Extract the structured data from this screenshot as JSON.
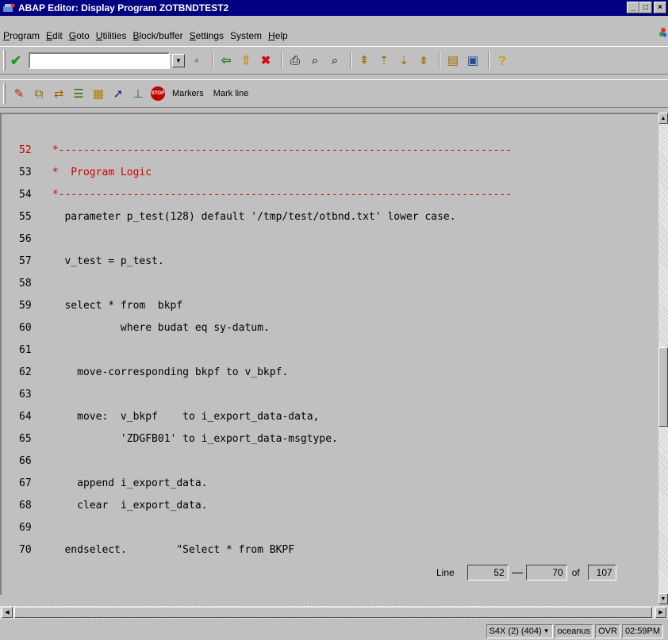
{
  "window": {
    "title": "ABAP Editor: Display Program ZOTBNDTEST2",
    "minimize": "_",
    "maximize": "□",
    "close": "×"
  },
  "menubar": {
    "items": [
      {
        "accel": "P",
        "rest": "rogram"
      },
      {
        "accel": "E",
        "rest": "dit"
      },
      {
        "accel": "G",
        "rest": "oto"
      },
      {
        "accel": "U",
        "rest": "tilities"
      },
      {
        "accel": "B",
        "rest": "lock/buffer"
      },
      {
        "accel": "S",
        "rest": "ettings"
      },
      {
        "accel": "",
        "rest": "System"
      },
      {
        "accel": "H",
        "rest": "elp"
      }
    ]
  },
  "toolbar1": {
    "command_value": "",
    "icons": {
      "check": "✔",
      "dropdown": "▼",
      "save": "▪",
      "back": "⇦",
      "exit": "⇧",
      "cancel": "✖",
      "print": "⎙",
      "find": "⌕",
      "find_next": "⌕",
      "first_page": "⇞",
      "prev_page": "⇡",
      "next_page": "⇣",
      "last_page": "⇟",
      "new_session": "▤",
      "shortcut": "▣",
      "help": "?"
    }
  },
  "toolbar2": {
    "icons": {
      "toggle_display_change": "✎",
      "other_object": "⧉",
      "active_inactive": "⇄",
      "check_syntax": "☰",
      "where_used": "▦",
      "where_used_list": "➚",
      "test": "⊥",
      "breakpoint": "STOP"
    },
    "markers_label": "Markers",
    "mark_line_label": "Mark line"
  },
  "editor": {
    "lines": [
      {
        "no": "52",
        "text": " *-------------------------------------------------------------------------",
        "red": true
      },
      {
        "no": "53",
        "text": " *  Program Logic",
        "red": true
      },
      {
        "no": "54",
        "text": " *-------------------------------------------------------------------------",
        "red": true
      },
      {
        "no": "55",
        "text": "   parameter p_test(128) default '/tmp/test/otbnd.txt' lower case.",
        "red": false
      },
      {
        "no": "56",
        "text": "",
        "red": false
      },
      {
        "no": "57",
        "text": "   v_test = p_test.",
        "red": false
      },
      {
        "no": "58",
        "text": "",
        "red": false
      },
      {
        "no": "59",
        "text": "   select * from  bkpf",
        "red": false
      },
      {
        "no": "60",
        "text": "            where budat eq sy-datum.",
        "red": false
      },
      {
        "no": "61",
        "text": "",
        "red": false
      },
      {
        "no": "62",
        "text": "     move-corresponding bkpf to v_bkpf.",
        "red": false
      },
      {
        "no": "63",
        "text": "",
        "red": false
      },
      {
        "no": "64",
        "text": "     move:  v_bkpf    to i_export_data-data,",
        "red": false
      },
      {
        "no": "65",
        "text": "            'ZDGFB01' to i_export_data-msgtype.",
        "red": false
      },
      {
        "no": "66",
        "text": "",
        "red": false
      },
      {
        "no": "67",
        "text": "     append i_export_data.",
        "red": false
      },
      {
        "no": "68",
        "text": "     clear  i_export_data.",
        "red": false
      },
      {
        "no": "69",
        "text": "",
        "red": false
      },
      {
        "no": "70",
        "text": "   endselect.        \"Select * from BKPF",
        "red": false
      }
    ],
    "counter": {
      "label": "Line",
      "from": "52",
      "to": "70",
      "of_label": "of",
      "total": "107"
    }
  },
  "statusbar": {
    "system": "S4X (2) (404)",
    "system_dropdown": "▼",
    "server": "oceanus",
    "mode": "OVR",
    "time": "02:59PM"
  }
}
